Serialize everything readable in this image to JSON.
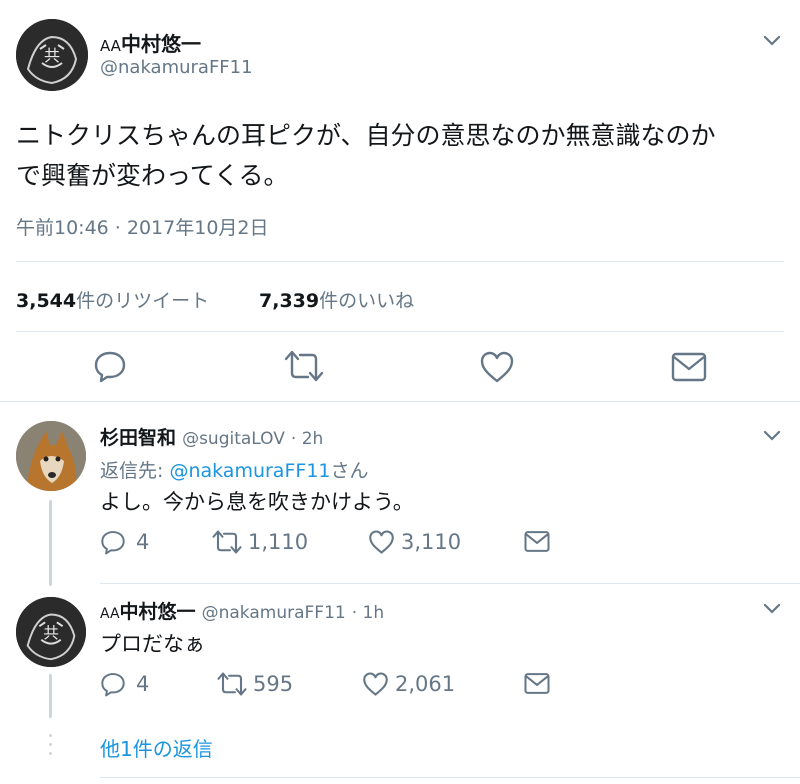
{
  "main_tweet": {
    "display_name_prefix": "AA",
    "display_name": "中村悠一",
    "handle": "@nakamuraFF11",
    "text_line1": "ニトクリスちゃんの耳ピクが、自分の意思なのか無意識なのか",
    "text_line2": "で興奮が変わってくる。",
    "timestamp": "午前10:46 · 2017年10月2日",
    "retweet_count": "3,544",
    "retweet_label": "件のリツイート",
    "like_count": "7,339",
    "like_label": "件のいいね"
  },
  "replies": [
    {
      "display_name": "杉田智和",
      "handle": "@sugitaLOV",
      "time": "· 2h",
      "reply_to_label": "返信先:",
      "reply_to_handle": "@nakamuraFF11",
      "reply_to_suffix": "さん",
      "text": "よし。今から息を吹きかけよう。",
      "replies": "4",
      "retweets": "1,110",
      "likes": "3,110"
    },
    {
      "display_name_prefix": "AA",
      "display_name": "中村悠一",
      "handle": "@nakamuraFF11",
      "time": "· 1h",
      "text": "プロだなぁ",
      "replies": "4",
      "retweets": "595",
      "likes": "2,061"
    }
  ],
  "more_replies": "他1件の返信",
  "colors": {
    "accent": "#1b95e0",
    "muted": "#657786",
    "divider": "#e1e8ed"
  },
  "icons": [
    "chevron-down-icon",
    "reply-icon",
    "retweet-icon",
    "like-icon",
    "share-icon"
  ]
}
